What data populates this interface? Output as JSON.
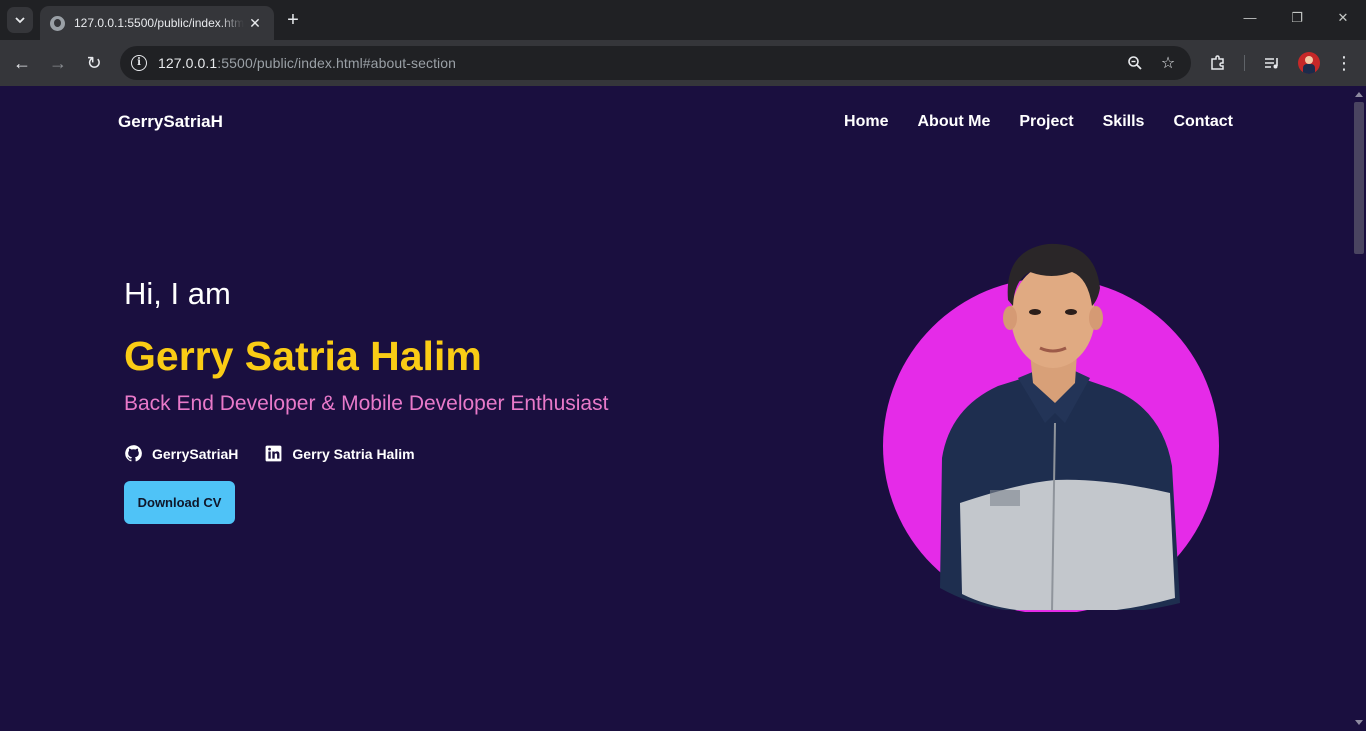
{
  "browser": {
    "tab_title": "127.0.0.1:5500/public/index.html",
    "url_host": "127.0.0.1",
    "url_rest": ":5500/public/index.html#about-section",
    "icons": [
      "tab-list-icon",
      "globe-icon",
      "close-icon",
      "plus-icon",
      "minimize-icon",
      "restore-icon",
      "back-icon",
      "forward-icon",
      "reload-icon",
      "info-icon",
      "zoom-icon",
      "star-icon",
      "extensions-icon",
      "media-icon",
      "avatar",
      "menu-icon"
    ]
  },
  "site": {
    "brand": "GerrySatriaH",
    "nav": [
      "Home",
      "About Me",
      "Project",
      "Skills",
      "Contact"
    ],
    "hero": {
      "greeting": "Hi, I am",
      "name": "Gerry Satria Halim",
      "role": "Back End Developer & Mobile Developer Enthusiast",
      "github": "GerrySatriaH",
      "linkedin": "Gerry Satria Halim",
      "cv_button": "Download CV"
    },
    "colors": {
      "background": "#1a0f3f",
      "name": "#facc15",
      "role": "#e879c9",
      "button": "#4fc3f7",
      "portrait_circle": "#e52be8"
    }
  }
}
